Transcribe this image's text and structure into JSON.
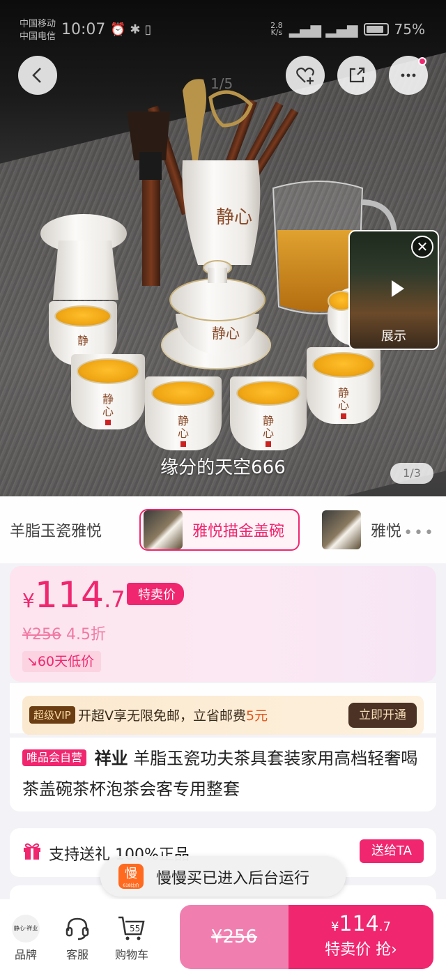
{
  "status": {
    "carrier1": "中国移动",
    "carrier2": "中国电信",
    "time": "10:07",
    "net_speed_top": "2.8",
    "net_speed_unit": "K/s",
    "battery": "75%"
  },
  "hero": {
    "image_counter": "1/5",
    "video_tag": "缘分的天空666",
    "pager": "1/3",
    "mini_video_label": "展示",
    "cup_mark_top": "静",
    "cup_mark_bottom": "心"
  },
  "sku": {
    "items": [
      {
        "label": "羊脂玉瓷雅悦"
      },
      {
        "label": "雅悦描金盖碗"
      },
      {
        "label": "雅悦"
      }
    ],
    "more": "•••"
  },
  "price": {
    "currency": "¥",
    "integer": "114",
    "decimal": ".7",
    "tag": "特卖价",
    "original": "¥256",
    "discount": "4.5折",
    "low_price_badge": "60天低价"
  },
  "vip": {
    "badge": "超级VIP",
    "text_prefix": "开超V享无限免邮，立省邮费",
    "amount": "5元",
    "button": "立即开通"
  },
  "product": {
    "badge": "唯品会自营",
    "brand": "祥业",
    "title": "羊脂玉瓷功夫茶具套装家用高档轻奢喝茶盖碗茶杯泡茶会客专用整套"
  },
  "gift": {
    "text": "支持送礼  100%正品",
    "button": "送给TA"
  },
  "toast": {
    "logo": "慢",
    "logo_sub": "618比价",
    "text": "慢慢买已进入后台运行"
  },
  "bottom": {
    "brand_logo": "静心·祥业",
    "brand": "品牌",
    "service": "客服",
    "cart": "购物车",
    "cart_count": "55",
    "orig_price": "¥256",
    "sale_currency": "¥",
    "sale_price": "114",
    "sale_decimal": ".7",
    "sale_label": "特卖价 抢"
  },
  "colors": {
    "accent": "#f0266f",
    "vip_dark": "#4b3224",
    "vip_bg": "#fbe9cf"
  }
}
